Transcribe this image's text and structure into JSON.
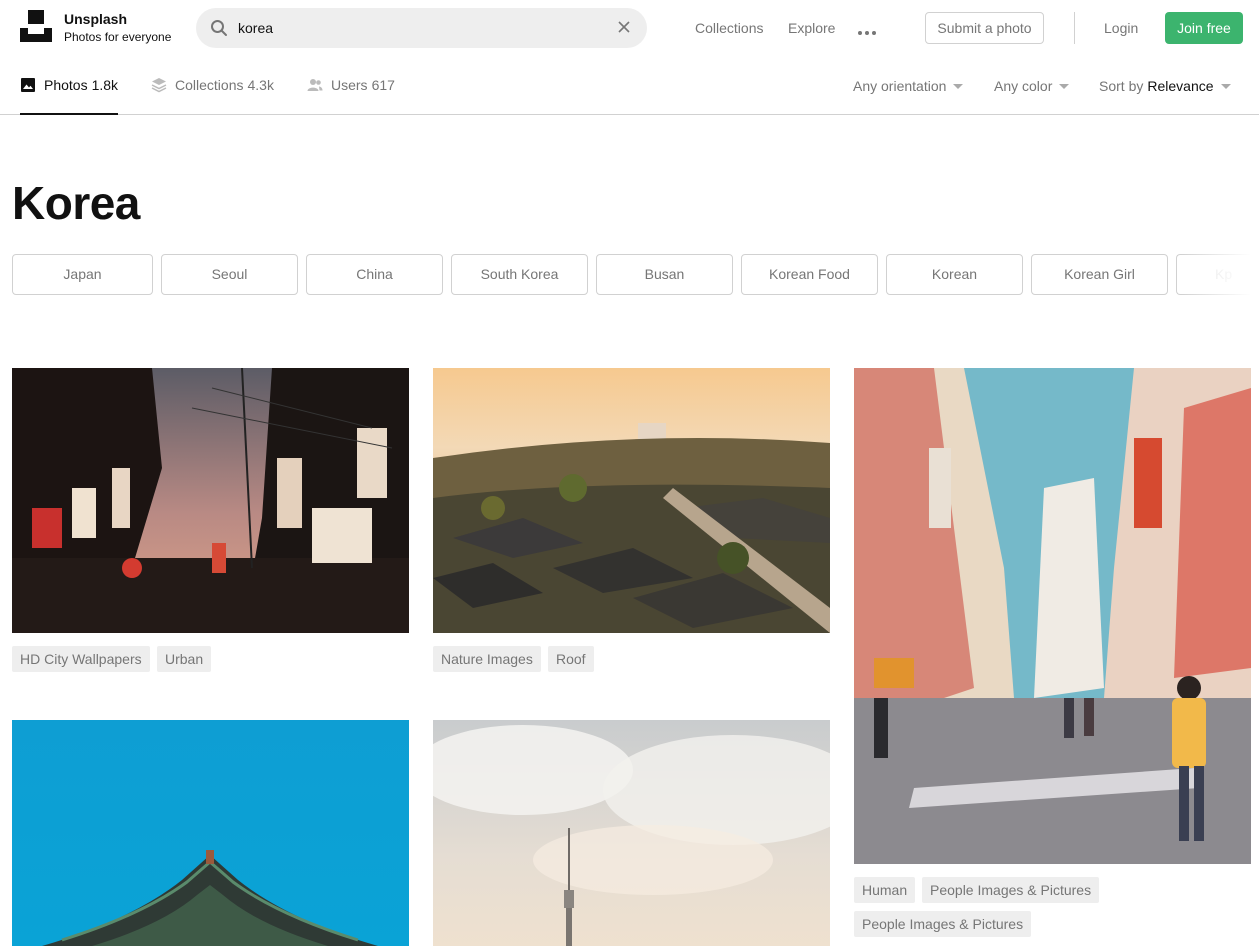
{
  "header": {
    "brand_name": "Unsplash",
    "brand_tagline": "Photos for everyone",
    "search_value": "korea",
    "nav": [
      "Collections",
      "Explore"
    ],
    "submit_label": "Submit a photo",
    "login_label": "Login",
    "join_label": "Join free",
    "join_color": "#3cb46e"
  },
  "tabs": [
    {
      "label": "Photos",
      "count": "1.8k",
      "icon": "image-icon",
      "active": true
    },
    {
      "label": "Collections",
      "count": "4.3k",
      "icon": "layers-icon",
      "active": false
    },
    {
      "label": "Users",
      "count": "617",
      "icon": "users-icon",
      "active": false
    }
  ],
  "filters": {
    "orientation": "Any orientation",
    "color": "Any color",
    "sort_prefix": "Sort by",
    "sort_value": "Relevance"
  },
  "page_title": "Korea",
  "related": [
    "Japan",
    "Seoul",
    "China",
    "South Korea",
    "Busan",
    "Korean Food",
    "Korean",
    "Korean Girl",
    "Kp"
  ],
  "photos": [
    {
      "subject": "neon-street-at-dusk",
      "tags": [
        "HD City Wallpapers",
        "Urban"
      ]
    },
    {
      "subject": "hanok-village-rooftops-at-sunset",
      "tags": [
        "Nature Images",
        "Roof"
      ]
    },
    {
      "subject": "busy-shopping-street",
      "tags": [
        "Human",
        "People Images & Pictures",
        "People Images & Pictures"
      ]
    },
    {
      "subject": "palace-roof-blue-sky",
      "tags": []
    },
    {
      "subject": "seoul-tower-cloudy-sky",
      "tags": []
    }
  ]
}
